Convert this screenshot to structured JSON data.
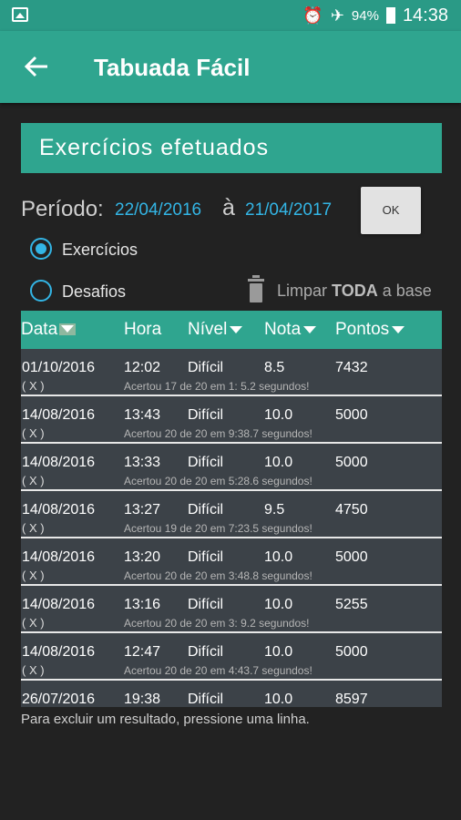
{
  "status": {
    "battery": "94%",
    "time": "14:38"
  },
  "appbar": {
    "title": "Tabuada Fácil"
  },
  "card": {
    "title": "Exercícios efetuados"
  },
  "period": {
    "label": "Período:",
    "from": "22/04/2016",
    "separator": "à",
    "to": "21/04/2017",
    "ok": "OK"
  },
  "options": {
    "exercicios": "Exercícios",
    "desafios": "Desafios",
    "selected": "exercicios"
  },
  "clear": {
    "prefix": "Limpar ",
    "bold": "TODA",
    "suffix": " a base"
  },
  "table": {
    "headers": [
      "Data",
      "Hora",
      "Nível",
      "Nota",
      "Pontos"
    ],
    "rows": [
      {
        "date": "01/10/2016",
        "time": "12:02",
        "level": "Difícil",
        "grade": "8.5",
        "points": "7432",
        "x": "( X )",
        "detail": "Acertou 17 de 20 em  1: 5.2 segundos!"
      },
      {
        "date": "14/08/2016",
        "time": "13:43",
        "level": "Difícil",
        "grade": "10.0",
        "points": "5000",
        "x": "( X )",
        "detail": "Acertou 20 de 20 em  9:38.7 segundos!"
      },
      {
        "date": "14/08/2016",
        "time": "13:33",
        "level": "Difícil",
        "grade": "10.0",
        "points": "5000",
        "x": "( X )",
        "detail": "Acertou 20 de 20 em  5:28.6 segundos!"
      },
      {
        "date": "14/08/2016",
        "time": "13:27",
        "level": "Difícil",
        "grade": "9.5",
        "points": "4750",
        "x": "( X )",
        "detail": "Acertou 19 de 20 em  7:23.5 segundos!"
      },
      {
        "date": "14/08/2016",
        "time": "13:20",
        "level": "Difícil",
        "grade": "10.0",
        "points": "5000",
        "x": "( X )",
        "detail": "Acertou 20 de 20 em  3:48.8 segundos!"
      },
      {
        "date": "14/08/2016",
        "time": "13:16",
        "level": "Difícil",
        "grade": "10.0",
        "points": "5255",
        "x": "( X )",
        "detail": "Acertou 20 de 20 em  3: 9.2 segundos!"
      },
      {
        "date": "14/08/2016",
        "time": "12:47",
        "level": "Difícil",
        "grade": "10.0",
        "points": "5000",
        "x": "( X )",
        "detail": "Acertou 20 de 20 em  4:43.7 segundos!"
      },
      {
        "date": "26/07/2016",
        "time": "19:38",
        "level": "Difícil",
        "grade": "10.0",
        "points": "8597",
        "x": "",
        "detail": ""
      }
    ]
  },
  "footer": "Para excluir um resultado, pressione uma linha.",
  "colors": {
    "accent": "#2fa58f",
    "link": "#33b5e5",
    "background": "#222222",
    "row": "#3c4248"
  }
}
